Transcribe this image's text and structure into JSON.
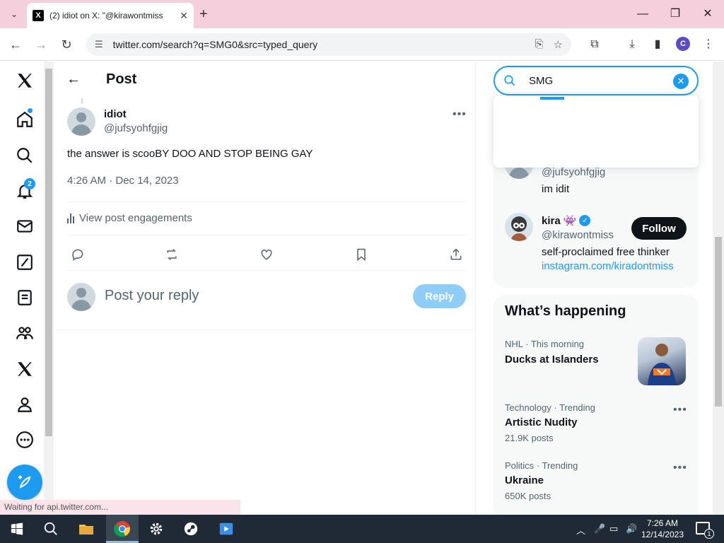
{
  "browser": {
    "tab_title": "(2) idiot on X: \"@kirawontmiss",
    "tab_favicon": "X",
    "url": "twitter.com/search?q=SMG0&src=typed_query",
    "profile_initial": "C",
    "status_text": "Waiting for api.twitter.com..."
  },
  "leftnav": {
    "notification_count": "2",
    "items": [
      "x-logo-icon",
      "home-icon",
      "explore-icon",
      "notifications-icon",
      "messages-icon",
      "grok-icon",
      "lists-icon",
      "communities-icon",
      "premium-icon",
      "profile-icon",
      "more-icon"
    ]
  },
  "main": {
    "header_title": "Post",
    "tweet": {
      "name": "idiot",
      "handle": "@jufsyohfgjig",
      "text": "the answer is scooBY DOO AND STOP BEING GAY",
      "time": "4:26 AM · Dec 14, 2023",
      "engagements_label": "View post engagements"
    },
    "reply_placeholder": "Post your reply",
    "reply_button": "Reply"
  },
  "right": {
    "search_value": "SMG",
    "users": [
      {
        "handle": "@jufsyohfgjig",
        "bio": "im idit"
      },
      {
        "name": "kira",
        "name_emoji": "👾",
        "handle": "@kirawontmiss",
        "bio": "self-proclaimed free thinker",
        "link": "instagram.com/kiradontmiss",
        "follow_label": "Follow"
      }
    ],
    "happening": {
      "title": "What’s happening",
      "trends": [
        {
          "meta": "NHL · This morning",
          "name": "Ducks at Islanders",
          "count": ""
        },
        {
          "meta": "Technology · Trending",
          "name": "Artistic Nudity",
          "count": "21.9K posts"
        },
        {
          "meta": "Politics · Trending",
          "name": "Ukraine",
          "count": "650K posts"
        }
      ]
    }
  },
  "taskbar": {
    "time": "7:26 AM",
    "date": "12/14/2023",
    "notifications": "1"
  },
  "colors": {
    "accent": "#1d9bf0",
    "tab_strip": "#f5cfdc",
    "taskbar": "#1f2a36"
  }
}
